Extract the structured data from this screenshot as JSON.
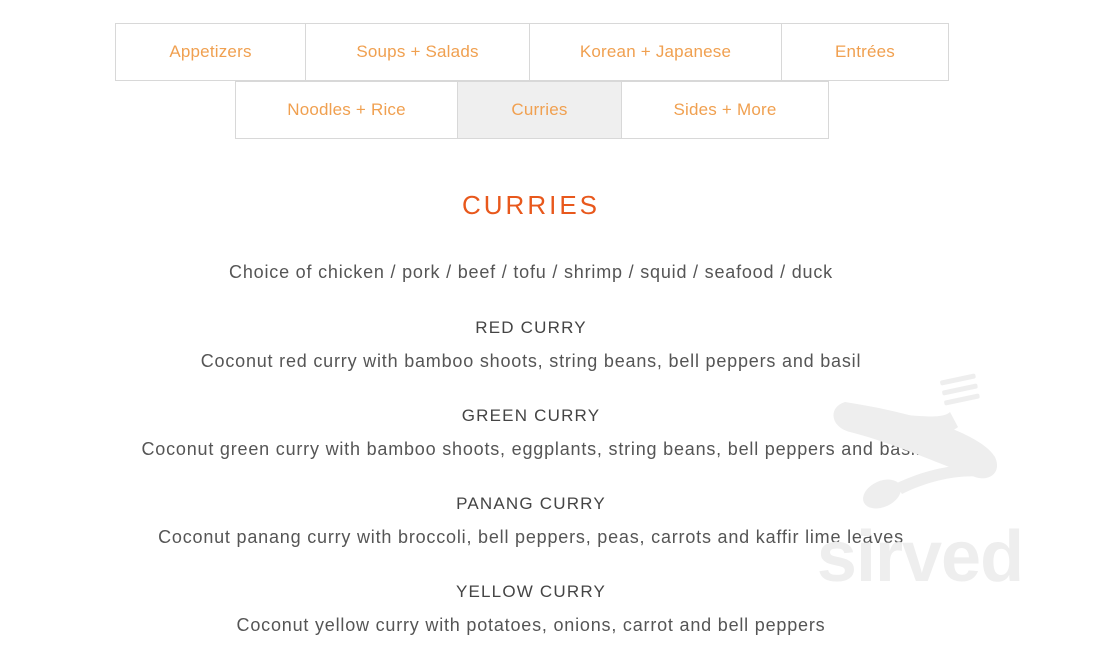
{
  "tabs": {
    "row1": [
      {
        "label": "Appetizers"
      },
      {
        "label": "Soups + Salads"
      },
      {
        "label": "Korean + Japanese"
      },
      {
        "label": "Entrées"
      }
    ],
    "row2": [
      {
        "label": "Noodles + Rice"
      },
      {
        "label": "Curries",
        "active": true
      },
      {
        "label": "Sides + More"
      }
    ]
  },
  "section": {
    "title": "CURRIES",
    "choice_line": "Choice of chicken / pork / beef / tofu / shrimp / squid / seafood / duck"
  },
  "items": [
    {
      "name": "RED CURRY",
      "description": "Coconut red curry with bamboo shoots, string beans, bell peppers and basil"
    },
    {
      "name": "GREEN CURRY",
      "description": "Coconut green curry with bamboo shoots, eggplants, string beans, bell peppers and basil"
    },
    {
      "name": "PANANG CURRY",
      "description": "Coconut panang curry with broccoli, bell peppers, peas, carrots and kaffir lime leaves"
    },
    {
      "name": "YELLOW CURRY",
      "description": "Coconut yellow curry with potatoes, onions, carrot and bell peppers"
    }
  ],
  "watermark": {
    "text": "sirved",
    "icon": "fork-spoon-icon"
  },
  "colors": {
    "tab_text": "#f0a050",
    "title": "#e8581c",
    "active_tab_bg": "#efefef",
    "border": "#d8d8d8"
  }
}
